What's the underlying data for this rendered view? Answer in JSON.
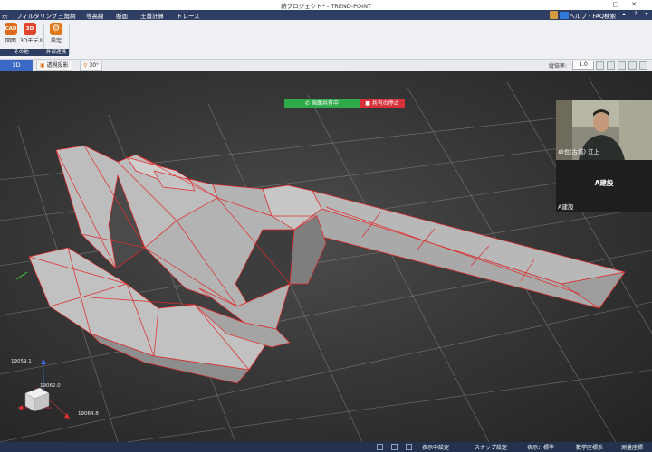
{
  "window": {
    "title": "新プロジェクト* - TREND-POINT"
  },
  "menu": {
    "items": [
      "示",
      "フィルタリング",
      "三角網",
      "等高線",
      "断面",
      "土量計算",
      "トレース"
    ],
    "help": "ヘルプ・FAQ検索"
  },
  "ribbon": {
    "buttons": [
      {
        "icon": "CAD",
        "label": "図面",
        "color": "#e06a1b"
      },
      {
        "icon": "3D",
        "label": "3Dモデル",
        "color": "#e0452b"
      },
      {
        "icon": "⚙",
        "label": "設定",
        "color": "#e07a18"
      }
    ],
    "groups": [
      "その他",
      "外部連携"
    ]
  },
  "viewbar": {
    "tab": "3D",
    "projection": "透視投影",
    "angle": "30°",
    "scale_label": "縦倍率:",
    "scale_value": "1.0"
  },
  "meeting": {
    "share_label": "画面共有中",
    "stop_label": "共有の停止",
    "participant_name": "卓也(古城) 江上",
    "card_title": "A建設",
    "card_sub": "A建設"
  },
  "axis": {
    "z_value": "19059.1",
    "y_value": "19062.0",
    "x_value": "19064.8"
  },
  "status": {
    "items": [
      "表示中設定",
      "スナップ設定",
      "表示：標準",
      "数学座標系",
      "測量座標"
    ]
  },
  "colors": {
    "menubar": "#2e3e63",
    "tab_active": "#3b67c5",
    "share": "#2faa4a",
    "stop": "#d8313b",
    "mesh_edge": "#e02a2a"
  }
}
